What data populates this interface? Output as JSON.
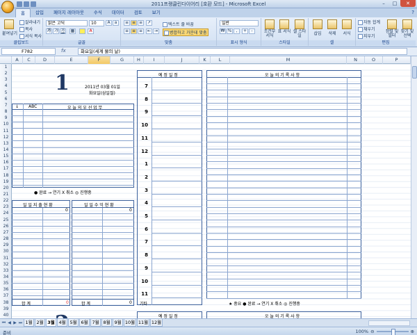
{
  "window": {
    "title": "2011프랭클린다이어리  [호환 모드] - Microsoft Excel"
  },
  "ribbon": {
    "tabs": [
      "홈",
      "삽입",
      "페이지 레이아웃",
      "수식",
      "데이터",
      "검토",
      "보기"
    ],
    "clipboard": {
      "paste": "붙여넣기",
      "cut": "잘라내기",
      "copy": "복사",
      "format_painter": "서식 복사",
      "label": "클립보드"
    },
    "font": {
      "name": "맑은 고딕",
      "size": "10",
      "label": "글꼴",
      "bold": "가",
      "italic": "가",
      "underline": "가"
    },
    "alignment": {
      "wrap": "텍스트 줄 바꿈",
      "merge": "병합하고 가운데 맞춤",
      "label": "맞춤"
    },
    "number": {
      "format": "일반",
      "label": "표시 형식"
    },
    "styles": {
      "conditional": "조건부 서식",
      "table": "표 서식",
      "cell": "셀 스타일",
      "label": "스타일"
    },
    "cells": {
      "insert": "삽입",
      "delete": "삭제",
      "format": "서식",
      "label": "셀"
    },
    "editing": {
      "autosum": "자동 합계",
      "fill": "채우기",
      "clear": "지우기",
      "sort": "정렬 및 필터",
      "find": "찾기 및 선택",
      "label": "편집"
    }
  },
  "formula_bar": {
    "name_box": "F782",
    "fx": "fx",
    "content": "화요일(세계 물의 날)"
  },
  "columns": [
    "A",
    "C",
    "D",
    "E",
    "F",
    "G",
    "H",
    "I",
    "J",
    "K",
    "L",
    "M",
    "N",
    "O",
    "P"
  ],
  "selected_column": "F",
  "rows": [
    "1",
    "2",
    "3",
    "4",
    "5",
    "6",
    "7",
    "8",
    "9",
    "10",
    "11",
    "12",
    "13",
    "14",
    "15",
    "16",
    "17",
    "18",
    "19",
    "20",
    "21",
    "22",
    "23",
    "24",
    "25",
    "26",
    "27",
    "28",
    "29",
    "30",
    "31",
    "32",
    "33",
    "34",
    "35",
    "36",
    "37",
    "38",
    "39",
    "40"
  ],
  "planner": {
    "day_number": "1",
    "date": "2011년 03월 01일",
    "weekday": "화요일(삼일절)",
    "priority_header": {
      "check": "↓",
      "abc": "ABC",
      "title": "오 늘 의 우 선 업 무"
    },
    "legend": "● 완료    → 연기    X 취소    ◎ 진행중",
    "expense_title": "일 일 지 출 현 황",
    "income_title": "일 일 수 익 현 황",
    "expense_zero": "0",
    "income_zero": "0",
    "total_label": "합  계",
    "expense_total": "0",
    "income_total": "0",
    "schedule_title": "예 정 일 정",
    "hours": [
      "7",
      "8",
      "9",
      "10",
      "11",
      "12",
      "1",
      "2",
      "3",
      "4",
      "5",
      "6",
      "7",
      "8",
      "9",
      "10",
      "11"
    ],
    "other_label": "기타",
    "record_title": "오 늘 의 기 록 사 항",
    "record_legend": "★ 중요    ● 완료    → 연기    X 취소    ◎ 진행중",
    "next_day_number": "2",
    "next_schedule_title": "예 정 일 정",
    "next_record_title": "오 늘 의 기 록 사 항"
  },
  "sheet_tabs": [
    "1월",
    "2월",
    "3월",
    "4월",
    "5월",
    "6월",
    "7월",
    "8월",
    "9월",
    "10월",
    "11월",
    "12월"
  ],
  "active_sheet": "3월",
  "status": {
    "ready": "준비",
    "zoom": "100%"
  },
  "colors": {
    "accent": "#3a5f9b",
    "legend_star": "#e03030",
    "total_red": "#e03030"
  }
}
